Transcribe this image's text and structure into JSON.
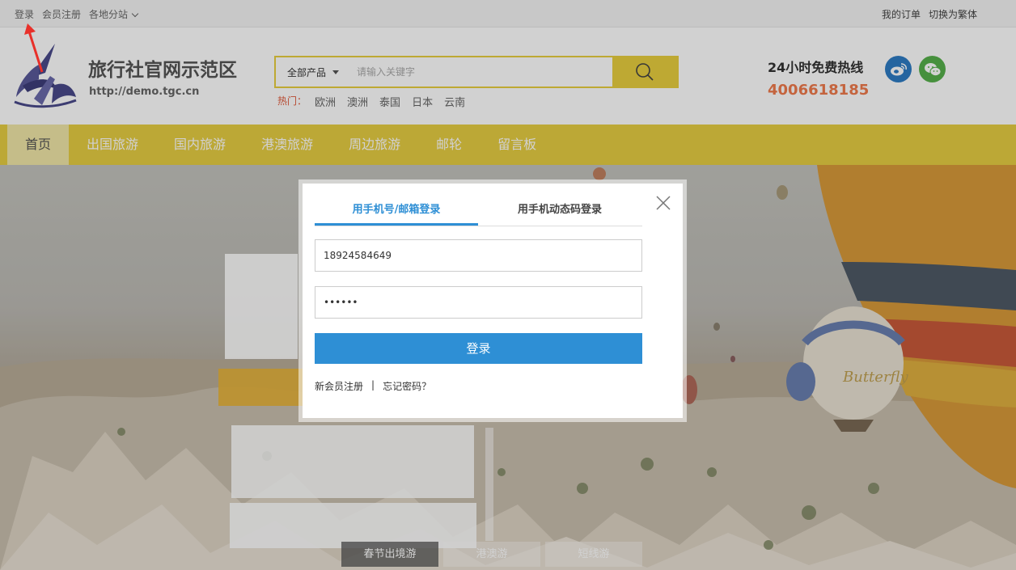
{
  "topbar": {
    "login": "登录",
    "register": "会员注册",
    "branches": "各地分站",
    "my_orders": "我的订单",
    "traditional": "切换为繁体"
  },
  "header": {
    "site_name": "旅行社官网示范区",
    "site_url": "http://demo.tgc.cn",
    "search_category": "全部产品",
    "search_placeholder": "请输入关键字",
    "hot_label": "热门：",
    "hot_keywords": [
      "欧洲",
      "澳洲",
      "泰国",
      "日本",
      "云南"
    ],
    "hotline_label": "24小时免费热线",
    "hotline_number": "4006618185",
    "social_icons": [
      "weibo-icon",
      "wechat-icon"
    ]
  },
  "nav": {
    "items": [
      "首页",
      "出国旅游",
      "国内旅游",
      "港澳旅游",
      "周边旅游",
      "邮轮",
      "留言板"
    ]
  },
  "banner": {
    "tabs": [
      "春节出境游",
      "港澳游",
      "短线游"
    ]
  },
  "login_modal": {
    "tab_account": "用手机号/邮箱登录",
    "tab_sms": "用手机动态码登录",
    "phone_value": "18924584649",
    "password_value": "••••••",
    "login_button": "登录",
    "register_link": "新会员注册",
    "separator": "|",
    "forgot_link": "忘记密码？"
  },
  "colors": {
    "accent_yellow": "#e6cd42",
    "primary_blue": "#2e8fd5",
    "hotline_orange": "#f07a4c"
  }
}
